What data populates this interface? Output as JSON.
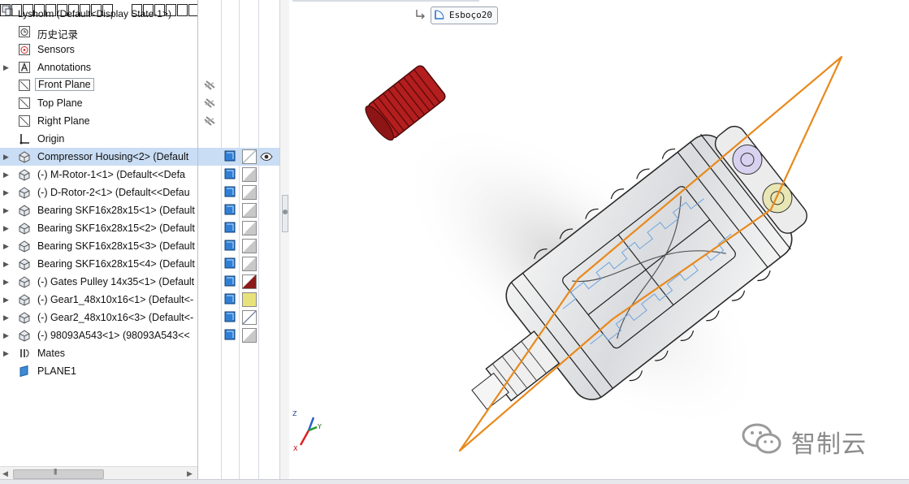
{
  "title_bar": {
    "root_label": "Lysholm  (Default<Display State-1>)"
  },
  "tree": {
    "items": [
      {
        "label": "历史记录",
        "icon": "history-icon",
        "expandable": false
      },
      {
        "label": "Sensors",
        "icon": "sensors-icon",
        "expandable": false
      },
      {
        "label": "Annotations",
        "icon": "annotations-icon",
        "expandable": true
      },
      {
        "label": "Front Plane",
        "icon": "plane-icon",
        "expandable": false
      },
      {
        "label": "Top Plane",
        "icon": "plane-icon",
        "expandable": false
      },
      {
        "label": "Right Plane",
        "icon": "plane-icon",
        "expandable": false
      },
      {
        "label": "Origin",
        "icon": "origin-icon",
        "expandable": false
      },
      {
        "label": "Compressor Housing<2> (Default",
        "icon": "part-icon",
        "expandable": true
      },
      {
        "label": "(-) M-Rotor-1<1> (Default<<Defa",
        "icon": "part-icon",
        "expandable": true
      },
      {
        "label": "(-) D-Rotor-2<1> (Default<<Defau",
        "icon": "part-icon",
        "expandable": true
      },
      {
        "label": "Bearing SKF16x28x15<1> (Default",
        "icon": "part-icon",
        "expandable": true
      },
      {
        "label": "Bearing SKF16x28x15<2> (Default",
        "icon": "part-icon",
        "expandable": true
      },
      {
        "label": "Bearing SKF16x28x15<3> (Default",
        "icon": "part-icon",
        "expandable": true
      },
      {
        "label": "Bearing SKF16x28x15<4> (Default",
        "icon": "part-icon",
        "expandable": true
      },
      {
        "label": "(-) Gates Pulley 14x35<1> (Default",
        "icon": "part-icon",
        "expandable": true
      },
      {
        "label": "(-) Gear1_48x10x16<1> (Default<-",
        "icon": "part-icon",
        "expandable": true
      },
      {
        "label": "(-) Gear2_48x10x16<3> (Default<-",
        "icon": "part-icon",
        "expandable": true
      },
      {
        "label": "(-) 98093A543<1> (98093A543<<",
        "icon": "part-icon",
        "expandable": true
      },
      {
        "label": "Mates",
        "icon": "mates-icon",
        "expandable": true
      },
      {
        "label": "PLANE1",
        "icon": "plane1-icon",
        "expandable": false
      }
    ],
    "selected_label": "Compressor Housing<2> (Default"
  },
  "display_pane": {
    "swatch_colors": [
      "#ffffff",
      "#ffffff",
      "#ffffff",
      "#ffffff",
      "#ffffff",
      "#ffffff",
      "#ffffff",
      "#8b1a1a",
      "#e8e27a",
      "#ffffff",
      "#ffffff"
    ]
  },
  "viewport": {
    "sketch_chip": "Esboço20",
    "triad": {
      "x": "X",
      "y": "Y",
      "z": "Z"
    },
    "watermark": "智制云"
  },
  "colors": {
    "selection": "#c9ddf4",
    "plane_outline": "#e8891c",
    "pulley": "#b41e1e"
  }
}
